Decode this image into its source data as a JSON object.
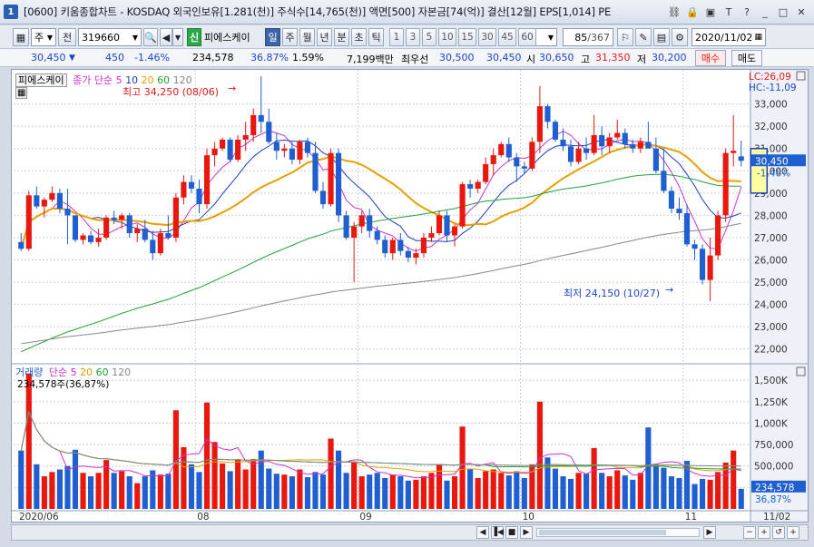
{
  "window": {
    "num": "1",
    "title": "[0600] 키움종합차트 - KOSDAQ 외국인보유[1.281(천)] 주식수[14,765(천)] 액면[500] 자본금[74(억)] 결산[12월] EPS[1,014] PE"
  },
  "toolbar": {
    "period_select": "주",
    "prev_label": "전",
    "code": "319660",
    "tag_label": "신",
    "stock_name": "피에스케이",
    "periods": [
      "일",
      "주",
      "월",
      "년",
      "분",
      "초",
      "틱"
    ],
    "selected_period": "일",
    "intervals": [
      "1",
      "3",
      "5",
      "10",
      "15",
      "30",
      "45",
      "60"
    ],
    "interval_select": "3",
    "count": "85",
    "count_total": "/367",
    "date": "2020/11/02"
  },
  "quote": {
    "price": "30,450",
    "change": "450",
    "change_pct": "-1.46%",
    "volume": "234,578",
    "vol_ratio": "36.87%",
    "turnover_pct": "1.59%",
    "amount": "7,199백만",
    "best_ask_label": "최우선",
    "best_ask": "30,500",
    "best_bid": "30,450",
    "open_label": "시",
    "open": "30,650",
    "high_label": "고",
    "high": "31,350",
    "low_label": "저",
    "low": "30,200",
    "buy_label": "매수",
    "sell_label": "매도"
  },
  "price_panel": {
    "legend_name": "피에스케이",
    "legend_ma_prefix": "종가 단순",
    "ma_periods": [
      "5",
      "10",
      "20",
      "60",
      "120"
    ],
    "ma_colors": [
      "#cc33cc",
      "#1f3fbf",
      "#e6a000",
      "#23a03a",
      "#888888"
    ],
    "high_annotation": "최고 34,250 (08/06)",
    "low_annotation": "최저 24,150 (10/27)",
    "lc_label": "LC:26,09",
    "hc_label": "HC:-11,09",
    "current_price_tag": "30,450",
    "current_pct_tag": "-1.46%"
  },
  "volume_panel": {
    "legend_name": "거래량",
    "legend_ma_prefix": "단순",
    "ma_periods": [
      "5",
      "20",
      "60",
      "120"
    ],
    "sub_legend": "234,578주(36,87%)",
    "current_tag": "234,578",
    "current_pct": "36,87%"
  },
  "axis": {
    "price_ticks": [
      "33,000",
      "32,000",
      "31,000",
      "30,000",
      "29,000",
      "28,000",
      "27,000",
      "26,000",
      "25,000",
      "24,000",
      "23,000",
      "22,000"
    ],
    "volume_ticks": [
      "1,500K",
      "1,250K",
      "1,000K",
      "750,000",
      "500,000",
      "250,000"
    ],
    "date_labels": [
      "2020/06",
      "08",
      "09",
      "10",
      "11",
      "11/02"
    ]
  },
  "colors": {
    "up": "#e8180e",
    "down": "#1f5fd0",
    "grid": "#c8d2e0"
  },
  "chart_data": {
    "type": "candlestick",
    "price_ylim": [
      21500,
      33800
    ],
    "volume_ylim": [
      0,
      1650000
    ],
    "candles": [
      [
        26800,
        27200,
        26400,
        26500
      ],
      [
        26500,
        29100,
        26400,
        28900
      ],
      [
        28900,
        29300,
        28300,
        28400
      ],
      [
        28400,
        28800,
        27900,
        28700
      ],
      [
        28700,
        29300,
        28600,
        29000
      ],
      [
        29000,
        29200,
        28100,
        28300
      ],
      [
        28300,
        29200,
        26700,
        28000
      ],
      [
        28000,
        28000,
        26800,
        26900
      ],
      [
        26900,
        27200,
        26700,
        27100
      ],
      [
        27100,
        27300,
        26700,
        26800
      ],
      [
        26800,
        27400,
        26600,
        27000
      ],
      [
        27000,
        28000,
        26900,
        27900
      ],
      [
        27900,
        28200,
        27600,
        27800
      ],
      [
        27800,
        28100,
        27400,
        28000
      ],
      [
        28000,
        28100,
        27000,
        27200
      ],
      [
        27200,
        27600,
        26800,
        27400
      ],
      [
        27400,
        27800,
        26800,
        26900
      ],
      [
        26900,
        27300,
        26000,
        26300
      ],
      [
        26300,
        27400,
        26200,
        27200
      ],
      [
        27200,
        28000,
        26900,
        27000
      ],
      [
        27000,
        29000,
        26800,
        28800
      ],
      [
        28800,
        29800,
        28500,
        29500
      ],
      [
        29500,
        29800,
        29000,
        29200
      ],
      [
        29200,
        29600,
        28100,
        28500
      ],
      [
        28500,
        31000,
        28300,
        30700
      ],
      [
        30700,
        31300,
        30200,
        31000
      ],
      [
        31000,
        31500,
        30900,
        31400
      ],
      [
        31400,
        31500,
        30400,
        30500
      ],
      [
        30500,
        31600,
        30400,
        31400
      ],
      [
        31400,
        32200,
        30900,
        31600
      ],
      [
        31600,
        32800,
        31300,
        32500
      ],
      [
        32500,
        34250,
        31700,
        32200
      ],
      [
        32200,
        32800,
        31200,
        31300
      ],
      [
        31300,
        31700,
        30500,
        30900
      ],
      [
        30900,
        31200,
        30600,
        31000
      ],
      [
        31000,
        31300,
        30300,
        30500
      ],
      [
        30500,
        31400,
        30300,
        31300
      ],
      [
        31300,
        31500,
        30600,
        30800
      ],
      [
        30800,
        31300,
        29000,
        29100
      ],
      [
        29100,
        29500,
        28300,
        28500
      ],
      [
        28500,
        31000,
        28400,
        30800
      ],
      [
        30800,
        31000,
        27700,
        28000
      ],
      [
        28000,
        28200,
        26900,
        27000
      ],
      [
        27000,
        27700,
        25000,
        27500
      ],
      [
        27500,
        28200,
        27200,
        28000
      ],
      [
        28000,
        28300,
        27000,
        27300
      ],
      [
        27300,
        27500,
        26700,
        26900
      ],
      [
        26900,
        27100,
        26100,
        26300
      ],
      [
        26300,
        27000,
        26000,
        26900
      ],
      [
        26900,
        27200,
        26200,
        26400
      ],
      [
        26400,
        26600,
        25900,
        26100
      ],
      [
        26100,
        26500,
        25800,
        26300
      ],
      [
        26300,
        27200,
        26100,
        27000
      ],
      [
        27000,
        27500,
        26800,
        27200
      ],
      [
        27200,
        28200,
        27100,
        28000
      ],
      [
        28000,
        28200,
        26800,
        27100
      ],
      [
        27100,
        27600,
        26600,
        27500
      ],
      [
        27500,
        29500,
        27400,
        29400
      ],
      [
        29400,
        29600,
        28800,
        29200
      ],
      [
        29200,
        29600,
        29000,
        29500
      ],
      [
        29500,
        30600,
        29400,
        30300
      ],
      [
        30300,
        31000,
        29800,
        30700
      ],
      [
        30700,
        31300,
        30600,
        31200
      ],
      [
        31200,
        31500,
        30400,
        30600
      ],
      [
        30600,
        30800,
        29500,
        30200
      ],
      [
        30200,
        30400,
        29900,
        30100
      ],
      [
        30100,
        31500,
        30000,
        31300
      ],
      [
        31300,
        33800,
        30800,
        32900
      ],
      [
        32900,
        33000,
        31900,
        32200
      ],
      [
        32200,
        32300,
        31300,
        31400
      ],
      [
        31400,
        31900,
        30900,
        31100
      ],
      [
        31100,
        31400,
        30200,
        30400
      ],
      [
        30400,
        31300,
        30300,
        31000
      ],
      [
        31000,
        31500,
        30500,
        30800
      ],
      [
        30800,
        32500,
        30700,
        31600
      ],
      [
        31600,
        32000,
        30700,
        31100
      ],
      [
        31100,
        31700,
        30800,
        31500
      ],
      [
        31500,
        32300,
        31400,
        31700
      ],
      [
        31700,
        31900,
        31000,
        31200
      ],
      [
        31200,
        31400,
        30800,
        31000
      ],
      [
        31000,
        31500,
        30800,
        31300
      ],
      [
        31300,
        32200,
        31000,
        31000
      ],
      [
        31000,
        31500,
        29900,
        30000
      ],
      [
        30000,
        31000,
        29000,
        29100
      ],
      [
        29100,
        29300,
        28100,
        28300
      ],
      [
        28300,
        28800,
        27800,
        28100
      ],
      [
        28100,
        28500,
        26600,
        26700
      ],
      [
        26700,
        26900,
        26000,
        26500
      ],
      [
        26500,
        26700,
        24900,
        25100
      ],
      [
        25100,
        27000,
        24150,
        26200
      ],
      [
        26200,
        28200,
        26000,
        28000
      ],
      [
        28000,
        31000,
        27700,
        30800
      ],
      [
        30800,
        32500,
        30200,
        30900
      ],
      [
        30650,
        31350,
        30200,
        30450
      ]
    ],
    "volumes": [
      680000,
      1580000,
      520000,
      380000,
      430000,
      460000,
      500000,
      690000,
      420000,
      380000,
      420000,
      570000,
      420000,
      440000,
      380000,
      300000,
      380000,
      450000,
      400000,
      410000,
      1150000,
      720000,
      520000,
      430000,
      1240000,
      780000,
      530000,
      440000,
      580000,
      460000,
      580000,
      680000,
      470000,
      410000,
      400000,
      380000,
      460000,
      370000,
      430000,
      400000,
      820000,
      680000,
      420000,
      540000,
      380000,
      400000,
      420000,
      360000,
      400000,
      380000,
      330000,
      340000,
      380000,
      420000,
      520000,
      330000,
      380000,
      960000,
      470000,
      360000,
      440000,
      460000,
      420000,
      390000,
      440000,
      360000,
      520000,
      1250000,
      600000,
      470000,
      380000,
      350000,
      420000,
      410000,
      710000,
      420000,
      380000,
      450000,
      390000,
      340000,
      420000,
      950000,
      520000,
      480000,
      380000,
      360000,
      560000,
      290000,
      350000,
      340000,
      430000,
      540000,
      680000,
      234578
    ]
  }
}
